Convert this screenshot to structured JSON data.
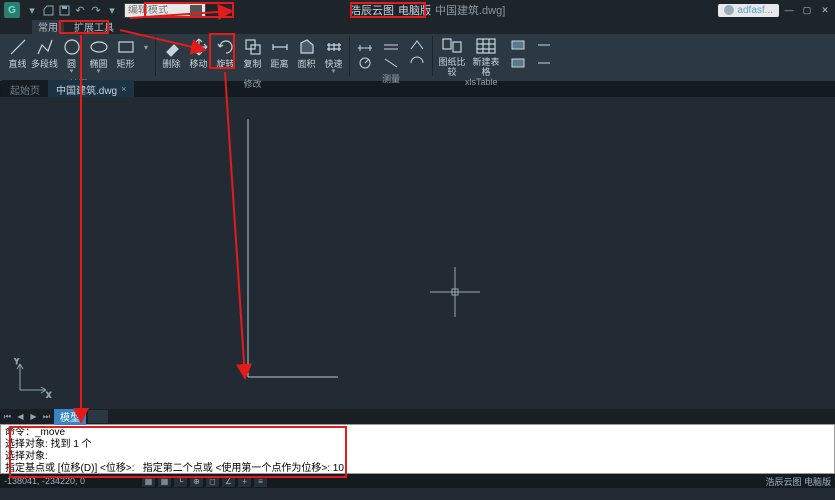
{
  "title": {
    "appname": "浩辰云图",
    "edition": "电脑版",
    "document": "中国建筑.dwg]",
    "user": "adfasf..."
  },
  "search": {
    "placeholder": "编辑模式"
  },
  "menutabs": [
    "常用",
    "扩展工具"
  ],
  "ribbon": {
    "draw": {
      "label": "绘图",
      "items": [
        {
          "id": "line",
          "label": "直线"
        },
        {
          "id": "polyline",
          "label": "多段线"
        },
        {
          "id": "circle",
          "label": "圆"
        },
        {
          "id": "ellipse",
          "label": "椭圆"
        },
        {
          "id": "rect",
          "label": "矩形"
        }
      ]
    },
    "modify": {
      "label": "修改",
      "items": [
        {
          "id": "erase",
          "label": "删除"
        },
        {
          "id": "move",
          "label": "移动"
        },
        {
          "id": "rotate",
          "label": "旋转"
        },
        {
          "id": "copy",
          "label": "复制"
        },
        {
          "id": "dist",
          "label": "距离"
        },
        {
          "id": "area",
          "label": "面积"
        },
        {
          "id": "quick",
          "label": "快速"
        }
      ]
    },
    "measure": {
      "label": "测量"
    },
    "compare": {
      "label": "图纸比较",
      "items": [
        {
          "id": "compare",
          "label": "图纸比较"
        },
        {
          "id": "newtable",
          "label": "新建表格"
        },
        {
          "id": "xlstable",
          "label": "xlsTable"
        }
      ]
    }
  },
  "doctabs": {
    "start": "起始页",
    "active": "中国建筑.dwg"
  },
  "modeltab": {
    "model": "模型"
  },
  "command": {
    "l1": "命令：_move",
    "l2": "选择对象: 找到 1 个",
    "l3": "选择对象:",
    "l4": "指定基点或 [位移(D)] <位移>:   指定第二个点或 <使用第一个点作为位移>: 10"
  },
  "status": {
    "coords": "-138041, -234220, 0",
    "brand": "浩辰云图 电脑版"
  }
}
